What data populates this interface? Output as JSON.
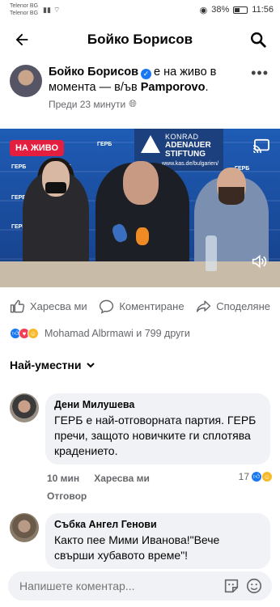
{
  "status": {
    "carrier1": "Telenor BG",
    "carrier2": "Telenor BG",
    "battery": "38%",
    "time": "11:56"
  },
  "header": {
    "title": "Бойко Борисов"
  },
  "post": {
    "author": "Бойко Борисов",
    "text_mid": "е на живо в момента — в/ъв",
    "place": "Pamporovo",
    "time": "Преди 23 минути",
    "live_label": "НА ЖИВО",
    "banner": {
      "line1": "KONRAD",
      "line2": "ADENAUER",
      "line3": "STIFTUNG",
      "url": "www.kas.de/bulgarien/"
    },
    "backdrop_tag": "ГЕРБ"
  },
  "actions": {
    "like": "Харесва ми",
    "comment": "Коментиране",
    "share": "Споделяне"
  },
  "reactions": {
    "summary": "Mohamad Albrmawi и 799 други"
  },
  "sort": {
    "label": "Най-уместни"
  },
  "comments": [
    {
      "name": "Дени Милушева",
      "text": "ГЕРБ е най-отговорната партия. ГЕРБ пречи, защото новичките ги сплотява крадението.",
      "time": "10 мин",
      "like_label": "Харесва ми",
      "reply_label": "Отговор",
      "reaction_count": "17"
    },
    {
      "name": "Събка Ангел Генови",
      "text": "Както пее Мими Иванова!\"Вече свърши хубавото време\"!"
    }
  ],
  "composer": {
    "placeholder": "Напишете коментар..."
  },
  "colors": {
    "accent": "#1877f2",
    "live": "#e41e3f"
  }
}
